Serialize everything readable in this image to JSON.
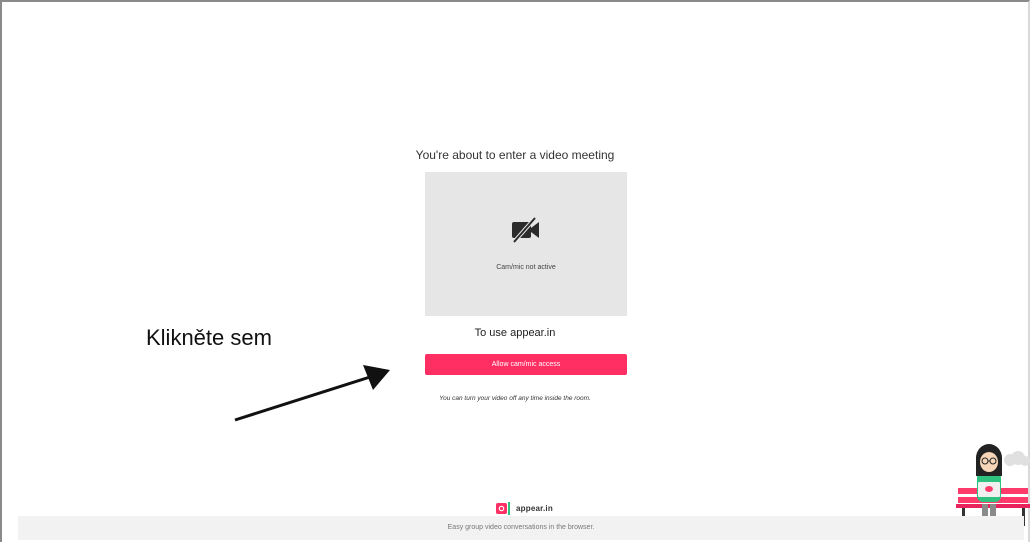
{
  "meeting": {
    "heading": "You're about to enter a video meeting",
    "cam_status": "Cam/mic not active",
    "purpose": "To use appear.in",
    "allow_label": "Allow cam/mic access",
    "note": "You can turn your video off any time inside the room.",
    "cam_icon": "camera-off-icon"
  },
  "annotation": {
    "label": "Klikněte sem",
    "arrow_icon": "arrow-icon"
  },
  "brand": {
    "name": "appear.in",
    "tagline": "Easy group video conversations in the browser.",
    "logo_icon": "appearin-logo-icon"
  },
  "colors": {
    "accent": "#ff2e63",
    "preview_bg": "#e6e6e6",
    "footer_bg": "#f2f2f2"
  }
}
